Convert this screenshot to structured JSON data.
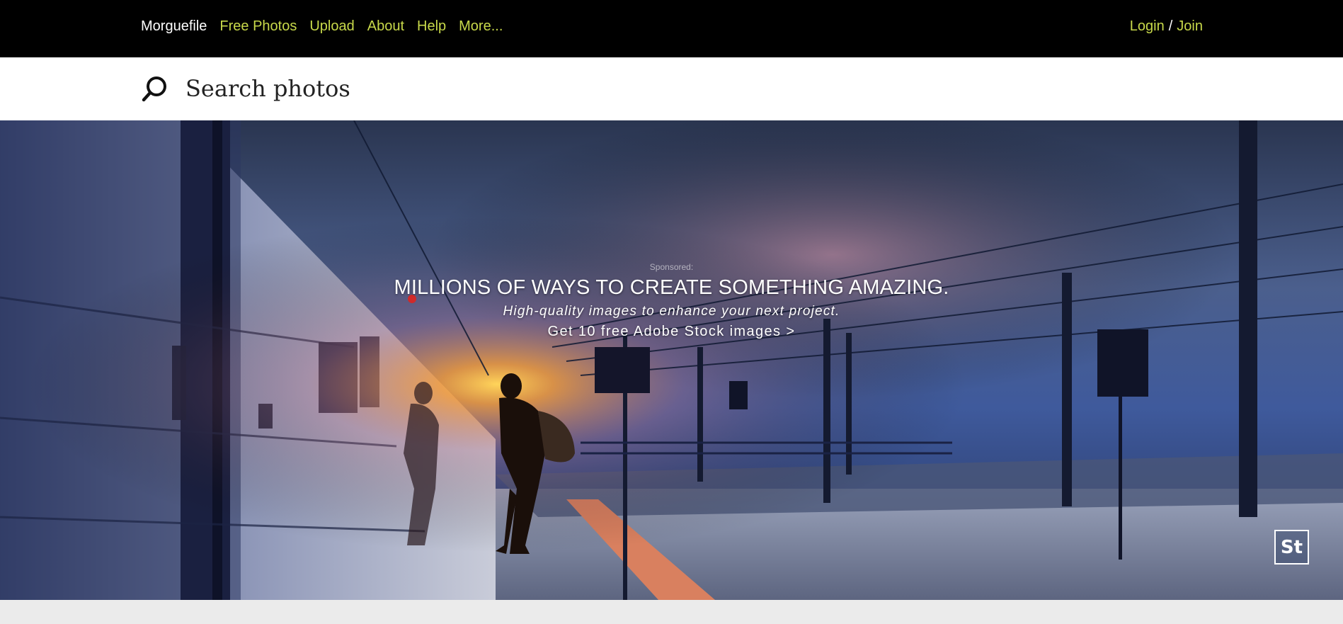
{
  "nav": {
    "brand": "Morguefile",
    "items": [
      {
        "label": "Free Photos"
      },
      {
        "label": "Upload"
      },
      {
        "label": "About"
      },
      {
        "label": "Help"
      },
      {
        "label": "More..."
      }
    ],
    "login": "Login",
    "separator": "/",
    "join": "Join",
    "colors": {
      "bar": "#000000",
      "link": "#c8d94a",
      "brand": "#ffffff"
    }
  },
  "search": {
    "icon": "search-icon",
    "placeholder": "Search photos",
    "value": ""
  },
  "hero": {
    "sponsored": "Sponsored:",
    "title": "MILLIONS OF WAYS TO CREATE SOMETHING AMAZING.",
    "subtitle": "High-quality images to enhance your next project.",
    "cta": "Get 10 free Adobe Stock images >",
    "badge": "St",
    "image": "train-platform-photo"
  }
}
